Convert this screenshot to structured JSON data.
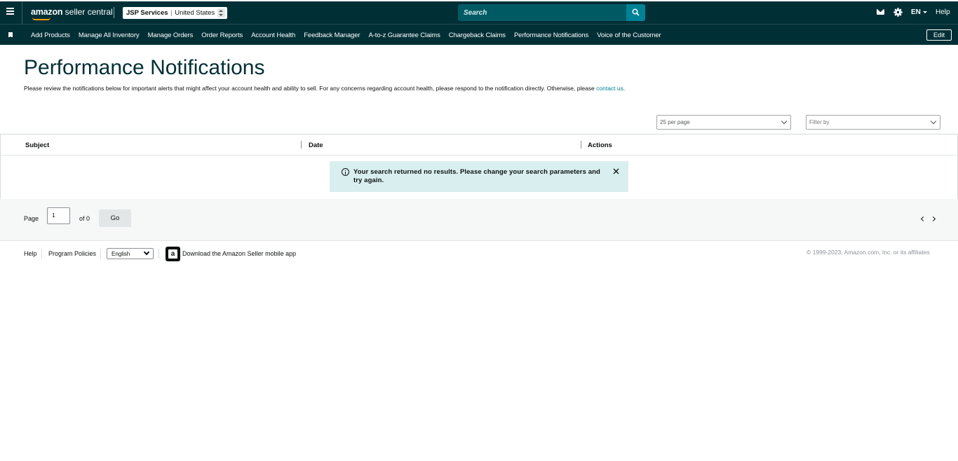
{
  "header": {
    "logo_brand": "amazon",
    "logo_suffix": " seller central",
    "account_name": "JSP Services",
    "account_separator": "|",
    "account_region": "United States",
    "search_placeholder": "Search",
    "language": "EN",
    "help": "Help"
  },
  "nav": {
    "items": [
      "Add Products",
      "Manage All Inventory",
      "Manage Orders",
      "Order Reports",
      "Account Health",
      "Feedback Manager",
      "A-to-z Guarantee Claims",
      "Chargeback Claims",
      "Performance Notifications",
      "Voice of the Customer"
    ],
    "edit": "Edit"
  },
  "main": {
    "title": "Performance Notifications",
    "description": "Please review the notifications below for important alerts that might affect your account health and ability to sell. For any concerns regarding account health, please respond to the notification directly. Otherwise, please ",
    "contact_link": "contact us",
    "description_end": ".",
    "per_page": "25 per page",
    "filter_placeholder": "Filter by"
  },
  "table": {
    "columns": [
      "Subject",
      "Date",
      "Actions"
    ],
    "alert_message": "Your search returned no results. Please change your search parameters and try again."
  },
  "pagination": {
    "page_label": "Page",
    "page_value": "1",
    "of_label": "of 0",
    "go": "Go"
  },
  "footer": {
    "help": "Help",
    "program_policies": "Program Policies",
    "language": "English",
    "download_app": "Download the Amazon Seller mobile app",
    "copyright": "© 1999-2023, Amazon.com, Inc. or its affiliates"
  },
  "colors": {
    "header_bg": "#002f36",
    "search_bg": "#005a64",
    "search_button": "#008296",
    "alert_bg": "#d9eeef",
    "link": "#008296"
  },
  "icons": [
    "hamburger-icon",
    "search-icon",
    "mail-icon",
    "gear-icon",
    "bookmark-icon",
    "info-icon",
    "close-icon",
    "chevron-down-icon",
    "chevron-left-icon",
    "chevron-right-icon",
    "amazon-app-icon"
  ]
}
